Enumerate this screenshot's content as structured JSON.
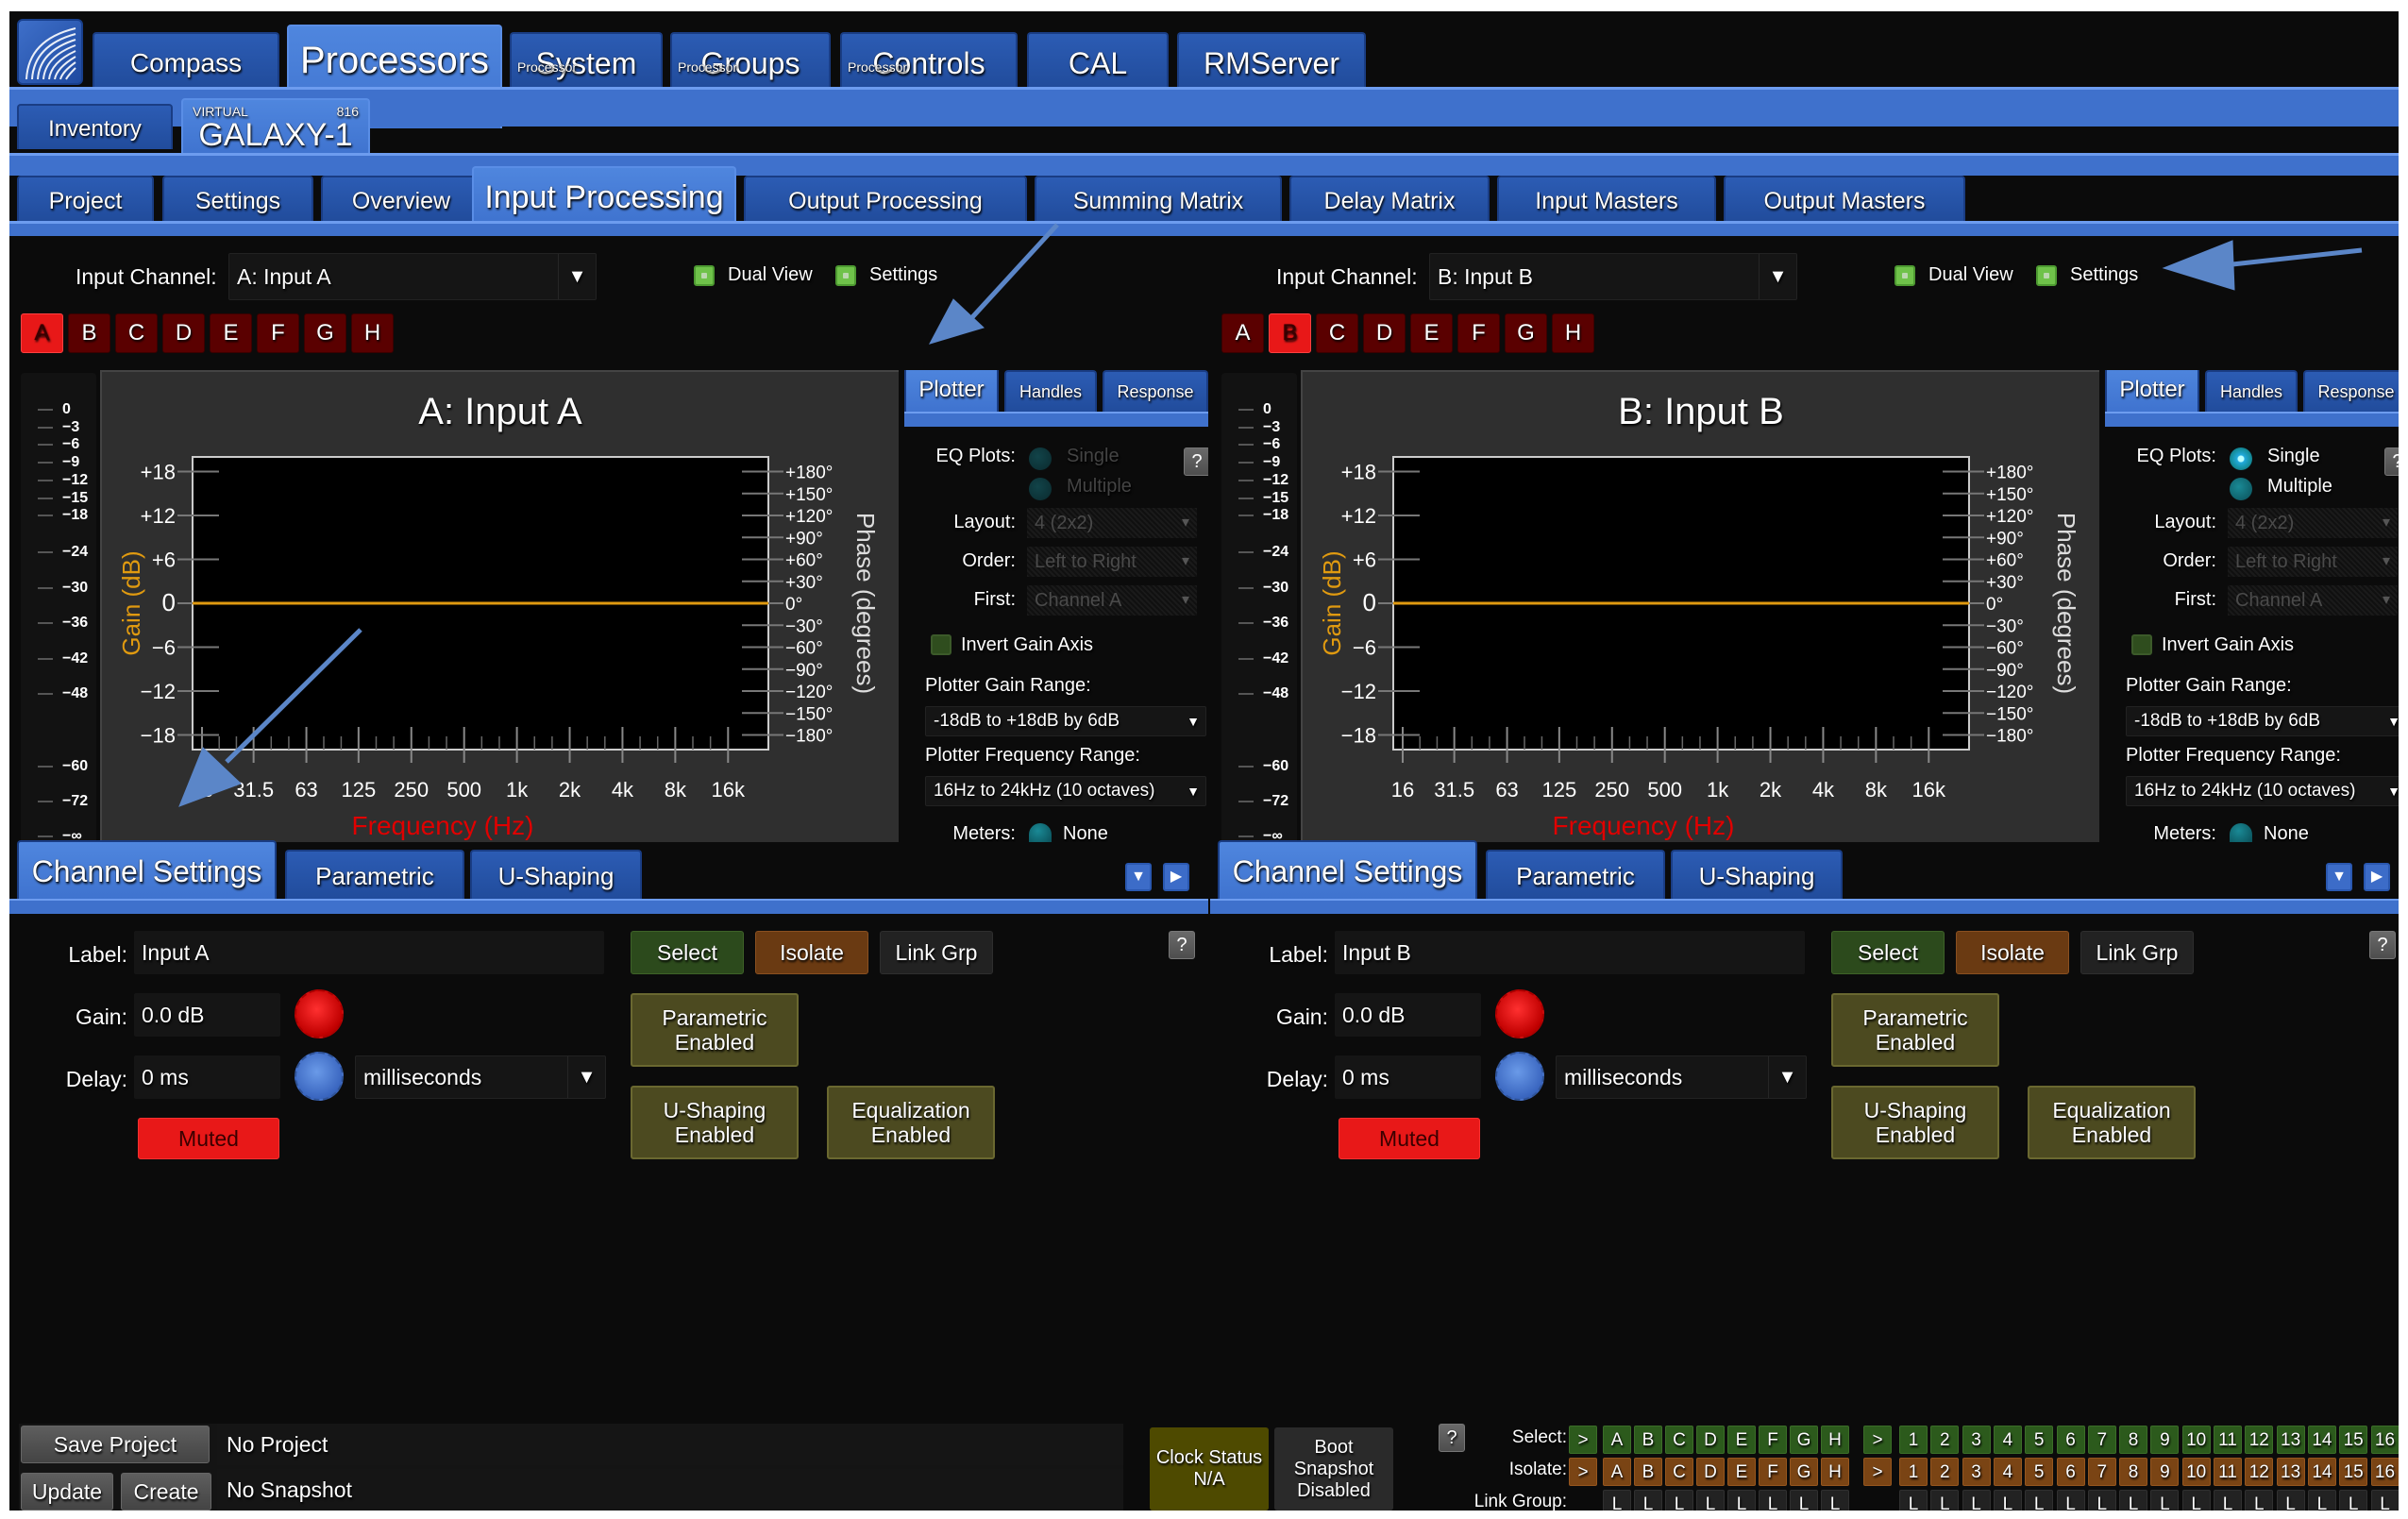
{
  "top_tabs": [
    {
      "label": "Compass",
      "sup": ""
    },
    {
      "label": "Processors",
      "sup": "",
      "active": true
    },
    {
      "label": "System",
      "sup": "Processor"
    },
    {
      "label": "Groups",
      "sup": "Processor"
    },
    {
      "label": "Controls",
      "sup": "Processor"
    },
    {
      "label": "CAL",
      "sup": ""
    },
    {
      "label": "RMServer",
      "sup": ""
    }
  ],
  "device_tabs": {
    "inventory": "Inventory",
    "device_top_left": "VIRTUAL",
    "device_top_right": "816",
    "device_name": "GALAXY-1"
  },
  "section_tabs": [
    "Project",
    "Settings",
    "Overview",
    "Input Processing",
    "Output Processing",
    "Summing Matrix",
    "Delay Matrix",
    "Input Masters",
    "Output Masters"
  ],
  "active_section": "Input Processing",
  "channel_buttons": [
    "A",
    "B",
    "C",
    "D",
    "E",
    "F",
    "G",
    "H"
  ],
  "panels": [
    {
      "input_channel_label": "Input Channel:",
      "input_channel_value": "A: Input A",
      "dual_view_label": "Dual View",
      "settings_label": "Settings",
      "active_channel": "A",
      "plot_title": "A: Input A",
      "settings_tabs": [
        "Plotter",
        "Handles",
        "Response"
      ],
      "eq_plots_label": "EQ Plots:",
      "eq_single": "Single",
      "eq_multiple": "Multiple",
      "eq_plots_enabled": false,
      "layout_label": "Layout:",
      "layout_value": "4 (2x2)",
      "order_label": "Order:",
      "order_value": "Left to Right",
      "first_label": "First:",
      "first_value": "Channel A",
      "invert_gain_label": "Invert Gain Axis",
      "gain_range_label": "Plotter Gain Range:",
      "gain_range_value": "-18dB to +18dB by 6dB",
      "freq_range_label": "Plotter Frequency Range:",
      "freq_range_value": "16Hz to 24kHz (10 octaves)",
      "meters_label": "Meters:",
      "meters_value": "None",
      "channel_tabs": [
        "Channel Settings",
        "Parametric",
        "U-Shaping"
      ],
      "label_lbl": "Label:",
      "label_value": "Input A",
      "gain_lbl": "Gain:",
      "gain_value": "0.0 dB",
      "delay_lbl": "Delay:",
      "delay_value": "0 ms",
      "delay_unit": "milliseconds",
      "muted_label": "Muted",
      "select_label": "Select",
      "isolate_label": "Isolate",
      "link_grp_label": "Link Grp",
      "parametric_enabled": "Parametric\nEnabled",
      "ushaping_enabled": "U-Shaping\nEnabled",
      "eq_enabled": "Equalization\nEnabled"
    },
    {
      "input_channel_label": "Input Channel:",
      "input_channel_value": "B: Input B",
      "dual_view_label": "Dual View",
      "settings_label": "Settings",
      "active_channel": "B",
      "plot_title": "B: Input B",
      "settings_tabs": [
        "Plotter",
        "Handles",
        "Response"
      ],
      "eq_plots_label": "EQ Plots:",
      "eq_single": "Single",
      "eq_multiple": "Multiple",
      "eq_plots_enabled": true,
      "layout_label": "Layout:",
      "layout_value": "4 (2x2)",
      "order_label": "Order:",
      "order_value": "Left to Right",
      "first_label": "First:",
      "first_value": "Channel A",
      "invert_gain_label": "Invert Gain Axis",
      "gain_range_label": "Plotter Gain Range:",
      "gain_range_value": "-18dB to +18dB by 6dB",
      "freq_range_label": "Plotter Frequency Range:",
      "freq_range_value": "16Hz to 24kHz (10 octaves)",
      "meters_label": "Meters:",
      "meters_value": "None",
      "channel_tabs": [
        "Channel Settings",
        "Parametric",
        "U-Shaping"
      ],
      "label_lbl": "Label:",
      "label_value": "Input B",
      "gain_lbl": "Gain:",
      "gain_value": "0.0 dB",
      "delay_lbl": "Delay:",
      "delay_value": "0 ms",
      "delay_unit": "milliseconds",
      "muted_label": "Muted",
      "select_label": "Select",
      "isolate_label": "Isolate",
      "link_grp_label": "Link Grp",
      "parametric_enabled": "Parametric\nEnabled",
      "ushaping_enabled": "U-Shaping\nEnabled",
      "eq_enabled": "Equalization\nEnabled"
    }
  ],
  "meter_scale": [
    "0",
    "−3",
    "−6",
    "−9",
    "−12",
    "−15",
    "−18",
    "−24",
    "−30",
    "−36",
    "−42",
    "−48",
    "−60",
    "−72",
    "−∞"
  ],
  "chart_data": [
    {
      "type": "line",
      "title": "A: Input A",
      "xlabel": "Frequency (Hz)",
      "ylabel": "Gain (dB)",
      "y2label": "Phase (degrees)",
      "xscale": "log",
      "xlim": [
        16,
        24000
      ],
      "ylim": [
        -20,
        20
      ],
      "y2lim": [
        -180,
        180
      ],
      "x_ticks": [
        "16",
        "31.5",
        "63",
        "125",
        "250",
        "500",
        "1k",
        "2k",
        "4k",
        "8k",
        "16k"
      ],
      "x_tick_values": [
        16,
        31.5,
        63,
        125,
        250,
        500,
        1000,
        2000,
        4000,
        8000,
        16000
      ],
      "y_ticks": [
        "+18",
        "+12",
        "+6",
        "0",
        "−6",
        "−12",
        "−18"
      ],
      "y_tick_values": [
        18,
        12,
        6,
        0,
        -6,
        -12,
        -18
      ],
      "y2_ticks": [
        "+180°",
        "+150°",
        "+120°",
        "+90°",
        "+60°",
        "+30°",
        "0°",
        "−30°",
        "−60°",
        "−90°",
        "−120°",
        "−150°",
        "−180°"
      ],
      "y2_tick_values": [
        180,
        150,
        120,
        90,
        60,
        30,
        0,
        -30,
        -60,
        -90,
        -120,
        -150,
        -180
      ],
      "series": [
        {
          "name": "Gain response",
          "color": "#e09a10",
          "x": [
            16,
            24000
          ],
          "y": [
            0,
            0
          ]
        }
      ],
      "colors": {
        "ylabel": "#e09a10",
        "xlabel": "#e00000"
      },
      "grid": false
    },
    {
      "type": "line",
      "title": "B: Input B",
      "xlabel": "Frequency (Hz)",
      "ylabel": "Gain (dB)",
      "y2label": "Phase (degrees)",
      "xscale": "log",
      "xlim": [
        16,
        24000
      ],
      "ylim": [
        -20,
        20
      ],
      "y2lim": [
        -180,
        180
      ],
      "x_ticks": [
        "16",
        "31.5",
        "63",
        "125",
        "250",
        "500",
        "1k",
        "2k",
        "4k",
        "8k",
        "16k"
      ],
      "x_tick_values": [
        16,
        31.5,
        63,
        125,
        250,
        500,
        1000,
        2000,
        4000,
        8000,
        16000
      ],
      "y_ticks": [
        "+18",
        "+12",
        "+6",
        "0",
        "−6",
        "−12",
        "−18"
      ],
      "y_tick_values": [
        18,
        12,
        6,
        0,
        -6,
        -12,
        -18
      ],
      "y2_ticks": [
        "+180°",
        "+150°",
        "+120°",
        "+90°",
        "+60°",
        "+30°",
        "0°",
        "−30°",
        "−60°",
        "−90°",
        "−120°",
        "−150°",
        "−180°"
      ],
      "y2_tick_values": [
        180,
        150,
        120,
        90,
        60,
        30,
        0,
        -30,
        -60,
        -90,
        -120,
        -150,
        -180
      ],
      "series": [
        {
          "name": "Gain response",
          "color": "#e09a10",
          "x": [
            16,
            24000
          ],
          "y": [
            0,
            0
          ]
        }
      ],
      "colors": {
        "ylabel": "#e09a10",
        "xlabel": "#e00000"
      },
      "grid": false
    }
  ],
  "footer": {
    "save_project": "Save Project",
    "project_status": "No Project",
    "update": "Update",
    "create": "Create",
    "snapshot_status": "No Snapshot",
    "clock_status": "Clock Status\nN/A",
    "boot_snapshot": "Boot\nSnapshot\nDisabled",
    "help": "?",
    "select_label": "Select:",
    "isolate_label": "Isolate:",
    "link_group_label": "Link Group:",
    "arrow": ">",
    "letters": [
      "A",
      "B",
      "C",
      "D",
      "E",
      "F",
      "G",
      "H"
    ],
    "numbers": [
      "1",
      "2",
      "3",
      "4",
      "5",
      "6",
      "7",
      "8",
      "9",
      "10",
      "11",
      "12",
      "13",
      "14",
      "15",
      "16"
    ],
    "link": "L"
  },
  "colors": {
    "accent_blue": "#3f71cc",
    "channel_active": "#e81818",
    "select_green": "#2c5a1c",
    "isolate_orange": "#7a4414",
    "response_line": "#e09a10",
    "annotation_arrow": "#5b86c8"
  }
}
